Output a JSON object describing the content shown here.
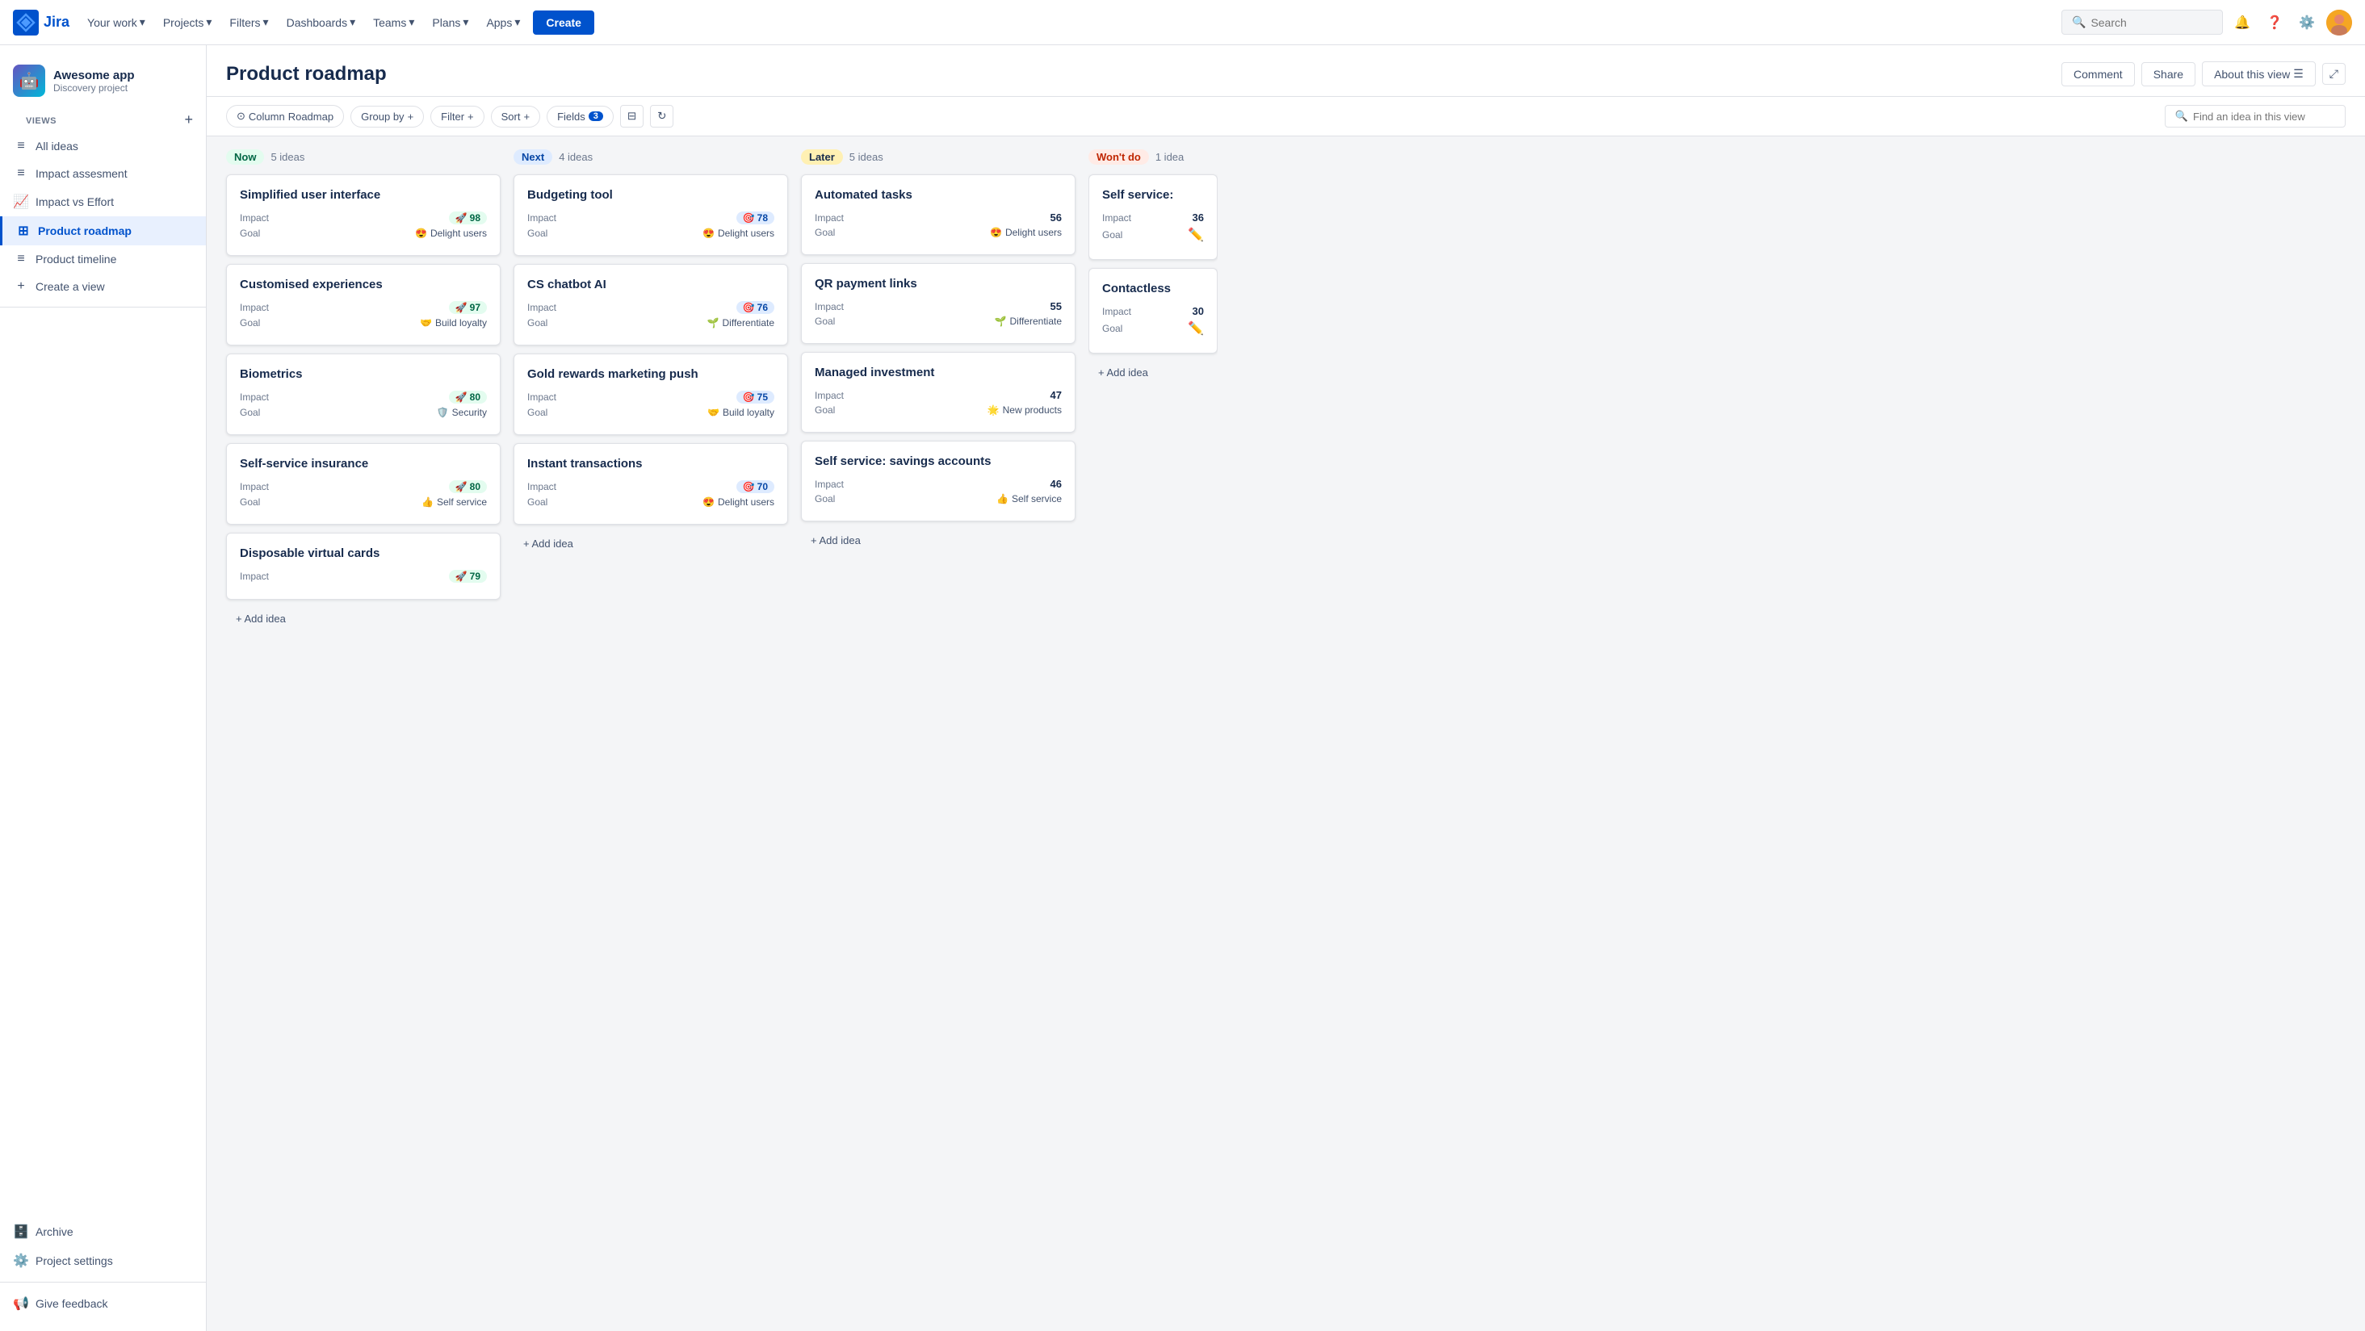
{
  "topnav": {
    "logo_text": "Jira",
    "nav_items": [
      {
        "label": "Your work",
        "has_dropdown": true
      },
      {
        "label": "Projects",
        "has_dropdown": true
      },
      {
        "label": "Filters",
        "has_dropdown": true
      },
      {
        "label": "Dashboards",
        "has_dropdown": true
      },
      {
        "label": "Teams",
        "has_dropdown": true
      },
      {
        "label": "Plans",
        "has_dropdown": true
      },
      {
        "label": "Apps",
        "has_dropdown": true
      }
    ],
    "create_label": "Create",
    "search_placeholder": "Search"
  },
  "sidebar": {
    "project_name": "Awesome app",
    "project_sub": "Discovery project",
    "views_label": "VIEWS",
    "add_view_icon": "+",
    "items": [
      {
        "label": "All ideas",
        "icon": "≡",
        "active": false
      },
      {
        "label": "Impact assesment",
        "icon": "≡",
        "active": false
      },
      {
        "label": "Impact vs Effort",
        "icon": "📈",
        "active": false
      },
      {
        "label": "Product roadmap",
        "icon": "⊞",
        "active": true
      },
      {
        "label": "Product timeline",
        "icon": "≡",
        "active": false
      },
      {
        "label": "Create a view",
        "icon": "+",
        "active": false
      }
    ],
    "archive_label": "Archive",
    "project_settings_label": "Project settings",
    "give_feedback_label": "Give feedback"
  },
  "page": {
    "title": "Product roadmap",
    "comment_btn": "Comment",
    "share_btn": "Share",
    "about_btn": "About this view"
  },
  "toolbar": {
    "column_label": "Column",
    "column_value": "Roadmap",
    "group_by_label": "Group by",
    "filter_label": "Filter",
    "sort_label": "Sort",
    "fields_label": "Fields",
    "fields_count": "3",
    "search_placeholder": "Find an idea in this view"
  },
  "columns": [
    {
      "id": "now",
      "label": "Now",
      "badge_class": "now",
      "count": "5 ideas",
      "cards": [
        {
          "title": "Simplified user interface",
          "impact_value": "98",
          "impact_class": "green",
          "impact_emoji": "🚀",
          "goal_emoji": "😍",
          "goal_label": "Delight users",
          "goal_color": "#de350b"
        },
        {
          "title": "Customised experiences",
          "impact_value": "97",
          "impact_class": "green",
          "impact_emoji": "🚀",
          "goal_emoji": "🤝",
          "goal_label": "Build loyalty",
          "goal_color": "#ff991f"
        },
        {
          "title": "Biometrics",
          "impact_value": "80",
          "impact_class": "green",
          "impact_emoji": "🚀",
          "goal_emoji": "🛡️",
          "goal_label": "Security",
          "goal_color": "#6554c0"
        },
        {
          "title": "Self-service insurance",
          "impact_value": "80",
          "impact_class": "green",
          "impact_emoji": "🚀",
          "goal_emoji": "👍",
          "goal_label": "Self service",
          "goal_color": "#ff991f"
        },
        {
          "title": "Disposable virtual cards",
          "impact_value": "79",
          "impact_class": "green",
          "impact_emoji": "🚀",
          "goal_emoji": "",
          "goal_label": "",
          "goal_color": ""
        }
      ],
      "add_idea": "+ Add idea"
    },
    {
      "id": "next",
      "label": "Next",
      "badge_class": "next",
      "count": "4 ideas",
      "cards": [
        {
          "title": "Budgeting tool",
          "impact_value": "78",
          "impact_class": "blue",
          "impact_emoji": "🎯",
          "goal_emoji": "😍",
          "goal_label": "Delight users",
          "goal_color": "#de350b"
        },
        {
          "title": "CS chatbot AI",
          "impact_value": "76",
          "impact_class": "blue",
          "impact_emoji": "🎯",
          "goal_emoji": "🌱",
          "goal_label": "Differentiate",
          "goal_color": "#36b37e"
        },
        {
          "title": "Gold rewards marketing push",
          "impact_value": "75",
          "impact_class": "blue",
          "impact_emoji": "🎯",
          "goal_emoji": "🤝",
          "goal_label": "Build loyalty",
          "goal_color": "#ff991f"
        },
        {
          "title": "Instant transactions",
          "impact_value": "70",
          "impact_class": "blue",
          "impact_emoji": "🎯",
          "goal_emoji": "😍",
          "goal_label": "Delight users",
          "goal_color": "#de350b"
        }
      ],
      "add_idea": "+ Add idea"
    },
    {
      "id": "later",
      "label": "Later",
      "badge_class": "later",
      "count": "5 ideas",
      "cards": [
        {
          "title": "Automated tasks",
          "impact_value": "56",
          "impact_class": "gray",
          "impact_emoji": "",
          "goal_emoji": "😍",
          "goal_label": "Delight users",
          "goal_color": "#de350b"
        },
        {
          "title": "QR payment links",
          "impact_value": "55",
          "impact_class": "gray",
          "impact_emoji": "",
          "goal_emoji": "🌱",
          "goal_label": "Differentiate",
          "goal_color": "#36b37e"
        },
        {
          "title": "Managed investment",
          "impact_value": "47",
          "impact_class": "gray",
          "impact_emoji": "",
          "goal_emoji": "🌟",
          "goal_label": "New products",
          "goal_color": "#6554c0"
        },
        {
          "title": "Self service: savings accounts",
          "impact_value": "46",
          "impact_class": "gray",
          "impact_emoji": "",
          "goal_emoji": "👍",
          "goal_label": "Self service",
          "goal_color": "#ff991f"
        }
      ],
      "add_idea": "+ Add idea"
    },
    {
      "id": "wontdo",
      "label": "Won't do",
      "badge_class": "wontdo",
      "count": "1 idea",
      "cards": [
        {
          "title": "Self service:",
          "impact_value": "36",
          "impact_class": "gray",
          "impact_emoji": "",
          "goal_emoji": "✏️",
          "goal_label": "",
          "goal_color": ""
        },
        {
          "title": "Contactless",
          "impact_value": "30",
          "impact_class": "gray",
          "impact_emoji": "",
          "goal_emoji": "✏️",
          "goal_label": "",
          "goal_color": ""
        }
      ],
      "add_idea": "+ Add idea"
    }
  ]
}
